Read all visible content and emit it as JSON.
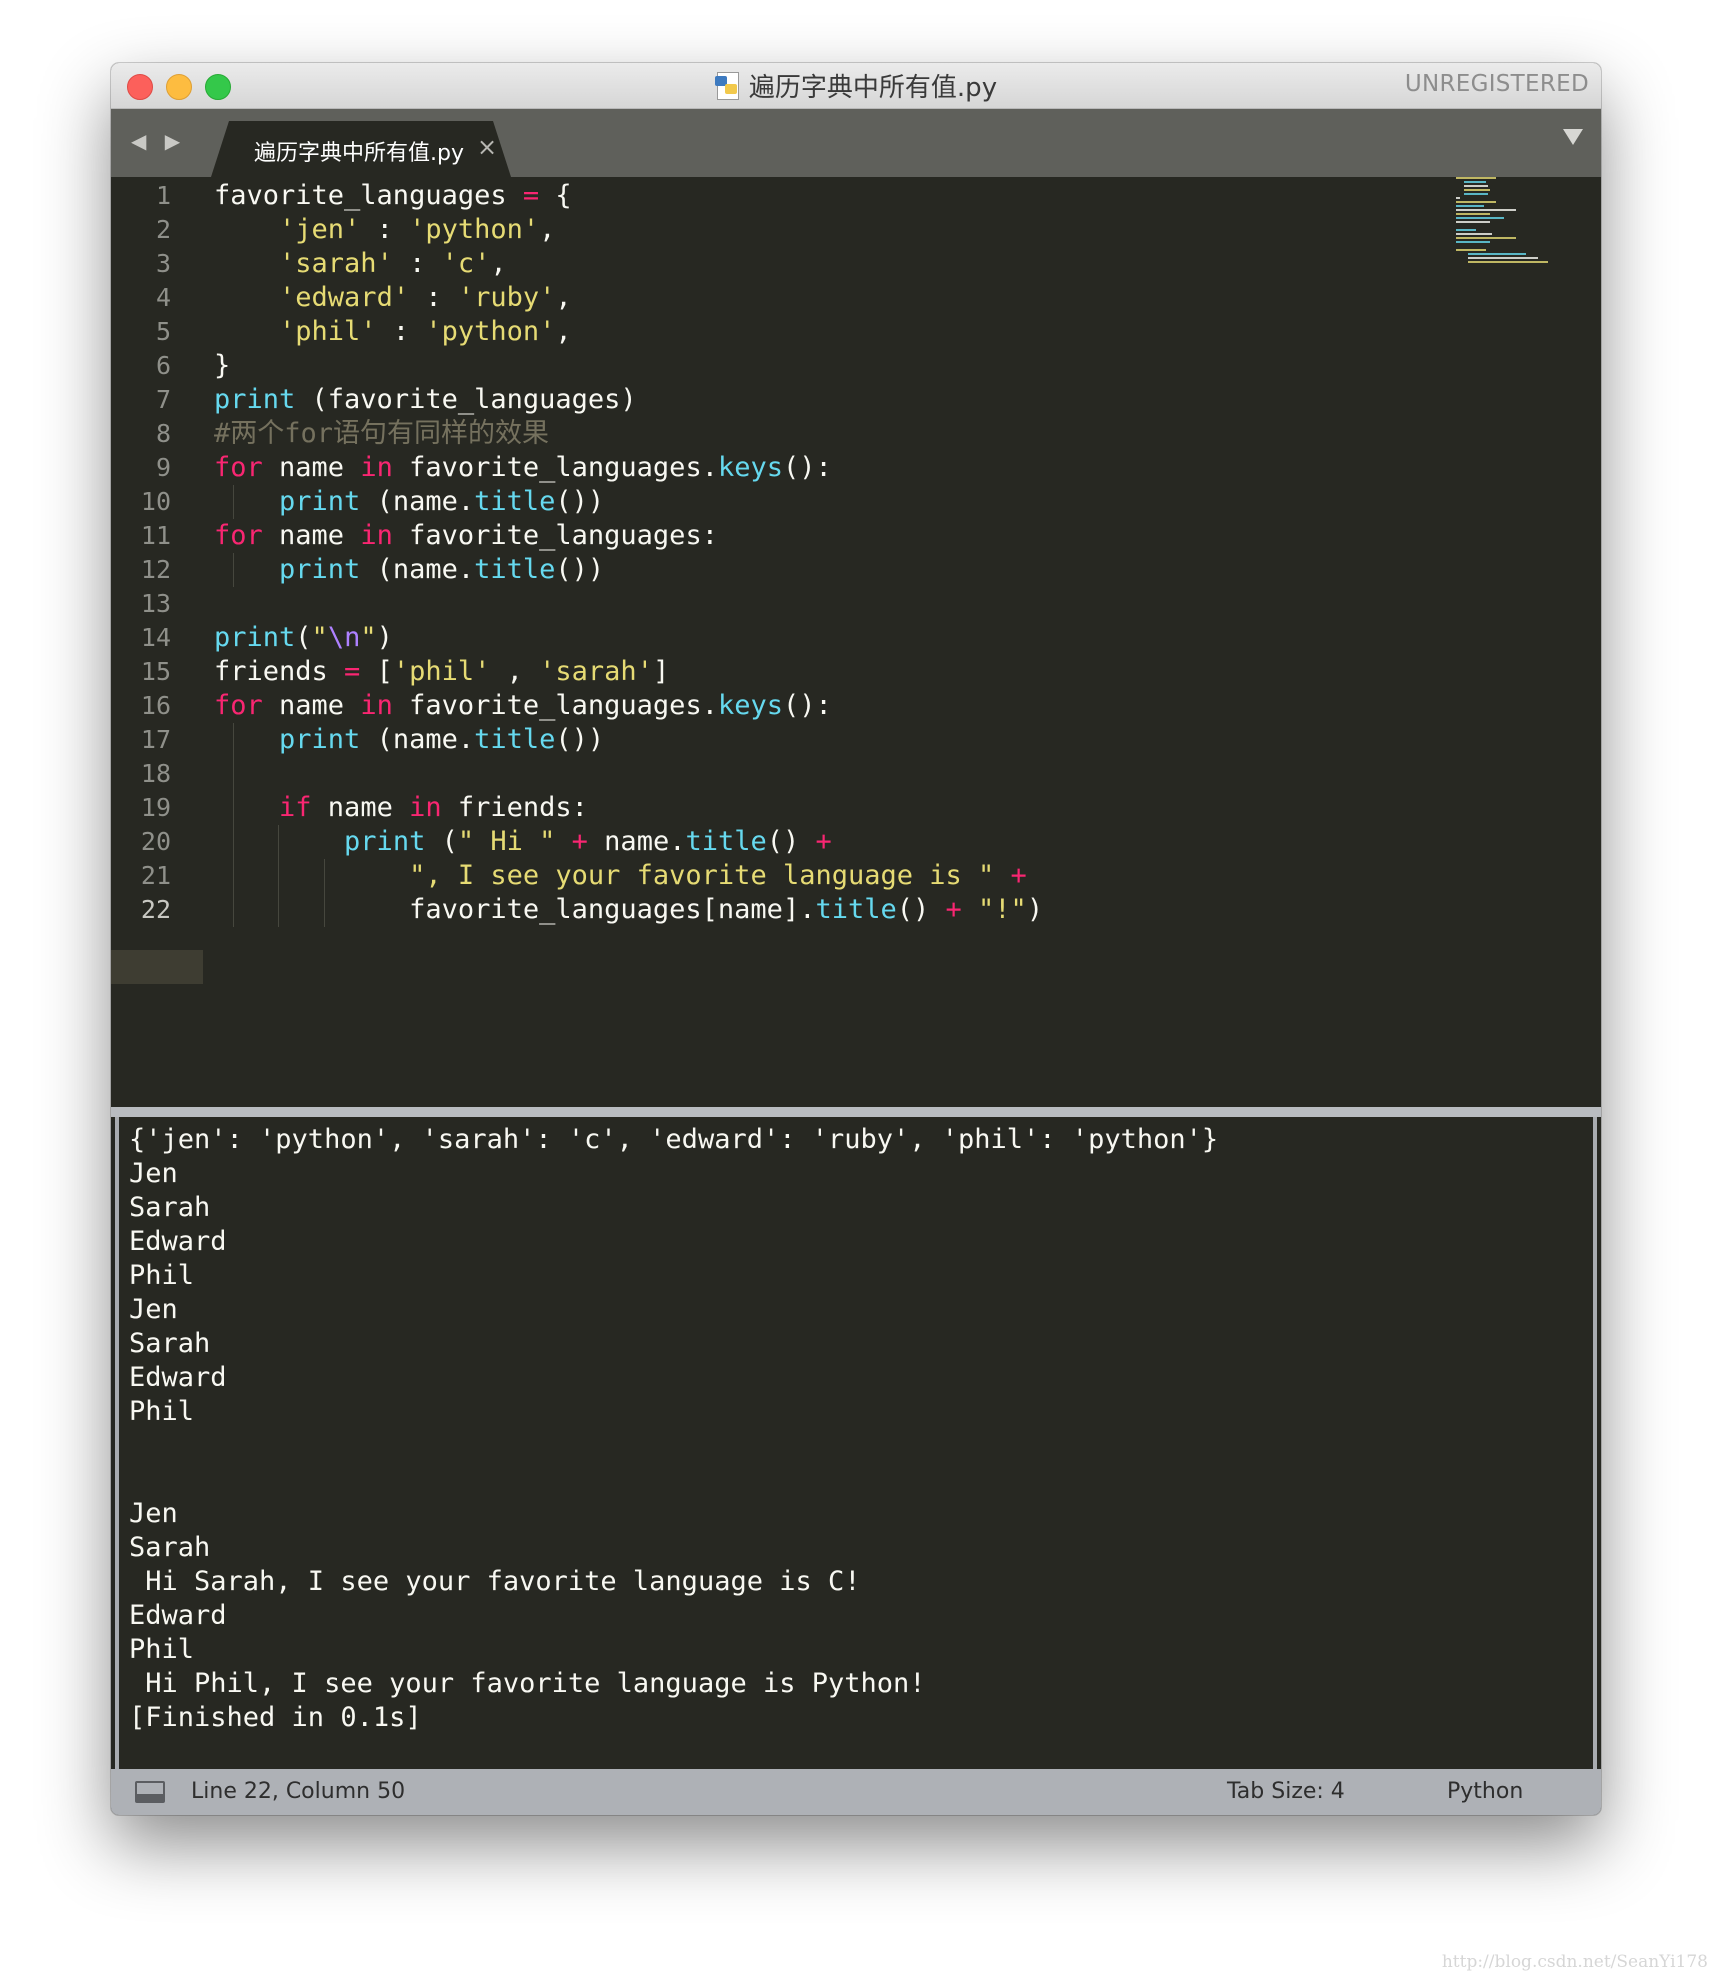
{
  "window": {
    "title": "遍历字典中所有值.py",
    "license_status": "UNREGISTERED",
    "colors": {
      "background": "#272822",
      "keyword": "#f92672",
      "function": "#66d9ef",
      "string": "#e6db74",
      "comment": "#75715e",
      "escape": "#ae81ff"
    }
  },
  "tabbar": {
    "nav_icons": "◀ ▶",
    "tab": {
      "label": "遍历字典中所有值.py",
      "close_glyph": "×"
    }
  },
  "editor": {
    "current_line": 22,
    "lines": [
      [
        {
          "t": "favorite_languages "
        },
        {
          "t": "=",
          "c": "kw"
        },
        {
          "t": " {"
        }
      ],
      [
        {
          "t": "    "
        },
        {
          "t": "'jen'",
          "c": "st"
        },
        {
          "t": " : "
        },
        {
          "t": "'python'",
          "c": "st"
        },
        {
          "t": ","
        }
      ],
      [
        {
          "t": "    "
        },
        {
          "t": "'sarah'",
          "c": "st"
        },
        {
          "t": " : "
        },
        {
          "t": "'c'",
          "c": "st"
        },
        {
          "t": ","
        }
      ],
      [
        {
          "t": "    "
        },
        {
          "t": "'edward'",
          "c": "st"
        },
        {
          "t": " : "
        },
        {
          "t": "'ruby'",
          "c": "st"
        },
        {
          "t": ","
        }
      ],
      [
        {
          "t": "    "
        },
        {
          "t": "'phil'",
          "c": "st"
        },
        {
          "t": " : "
        },
        {
          "t": "'python'",
          "c": "st"
        },
        {
          "t": ","
        }
      ],
      [
        {
          "t": "}"
        }
      ],
      [
        {
          "t": "print",
          "c": "fn"
        },
        {
          "t": " (favorite_languages)"
        }
      ],
      [
        {
          "t": "#两个for语句有同样的效果",
          "c": "cm"
        }
      ],
      [
        {
          "t": "for",
          "c": "kw"
        },
        {
          "t": " name "
        },
        {
          "t": "in",
          "c": "kw"
        },
        {
          "t": " favorite_languages."
        },
        {
          "t": "keys",
          "c": "fn"
        },
        {
          "t": "():"
        }
      ],
      [
        {
          "t": "    "
        },
        {
          "t": "print",
          "c": "fn"
        },
        {
          "t": " (name."
        },
        {
          "t": "title",
          "c": "fn"
        },
        {
          "t": "())"
        }
      ],
      [
        {
          "t": "for",
          "c": "kw"
        },
        {
          "t": " name "
        },
        {
          "t": "in",
          "c": "kw"
        },
        {
          "t": " favorite_languages:"
        }
      ],
      [
        {
          "t": "    "
        },
        {
          "t": "print",
          "c": "fn"
        },
        {
          "t": " (name."
        },
        {
          "t": "title",
          "c": "fn"
        },
        {
          "t": "())"
        }
      ],
      [
        {
          "t": ""
        }
      ],
      [
        {
          "t": "print",
          "c": "fn"
        },
        {
          "t": "("
        },
        {
          "t": "\"",
          "c": "st"
        },
        {
          "t": "\\n",
          "c": "es"
        },
        {
          "t": "\"",
          "c": "st"
        },
        {
          "t": ")"
        }
      ],
      [
        {
          "t": "friends "
        },
        {
          "t": "=",
          "c": "kw"
        },
        {
          "t": " ["
        },
        {
          "t": "'phil'",
          "c": "st"
        },
        {
          "t": " , "
        },
        {
          "t": "'sarah'",
          "c": "st"
        },
        {
          "t": "]"
        }
      ],
      [
        {
          "t": "for",
          "c": "kw"
        },
        {
          "t": " name "
        },
        {
          "t": "in",
          "c": "kw"
        },
        {
          "t": " favorite_languages."
        },
        {
          "t": "keys",
          "c": "fn"
        },
        {
          "t": "():"
        }
      ],
      [
        {
          "t": "    "
        },
        {
          "t": "print",
          "c": "fn"
        },
        {
          "t": " (name."
        },
        {
          "t": "title",
          "c": "fn"
        },
        {
          "t": "())"
        }
      ],
      [
        {
          "t": ""
        }
      ],
      [
        {
          "t": "    "
        },
        {
          "t": "if",
          "c": "kw"
        },
        {
          "t": " name "
        },
        {
          "t": "in",
          "c": "kw"
        },
        {
          "t": " friends:"
        }
      ],
      [
        {
          "t": "        "
        },
        {
          "t": "print",
          "c": "fn"
        },
        {
          "t": " ("
        },
        {
          "t": "\" Hi \"",
          "c": "st"
        },
        {
          "t": " "
        },
        {
          "t": "+",
          "c": "kw"
        },
        {
          "t": " name."
        },
        {
          "t": "title",
          "c": "fn"
        },
        {
          "t": "() "
        },
        {
          "t": "+",
          "c": "kw"
        }
      ],
      [
        {
          "t": "            "
        },
        {
          "t": "\", I see your favorite language is \"",
          "c": "st"
        },
        {
          "t": " "
        },
        {
          "t": "+",
          "c": "kw"
        }
      ],
      [
        {
          "t": "            favorite_languages[name]."
        },
        {
          "t": "title",
          "c": "fn"
        },
        {
          "t": "() "
        },
        {
          "t": "+",
          "c": "kw"
        },
        {
          "t": " "
        },
        {
          "t": "\"!\"",
          "c": "st"
        },
        {
          "t": ")"
        }
      ]
    ]
  },
  "output": {
    "lines": [
      "{'jen': 'python', 'sarah': 'c', 'edward': 'ruby', 'phil': 'python'}",
      "Jen",
      "Sarah",
      "Edward",
      "Phil",
      "Jen",
      "Sarah",
      "Edward",
      "Phil",
      "",
      "",
      "Jen",
      "Sarah",
      " Hi Sarah, I see your favorite language is C!",
      "Edward",
      "Phil",
      " Hi Phil, I see your favorite language is Python!",
      "[Finished in 0.1s]"
    ]
  },
  "statusbar": {
    "position": "Line 22, Column 50",
    "tab_size": "Tab Size: 4",
    "syntax": "Python"
  },
  "watermark": "http://blog.csdn.net/SeanYi178"
}
